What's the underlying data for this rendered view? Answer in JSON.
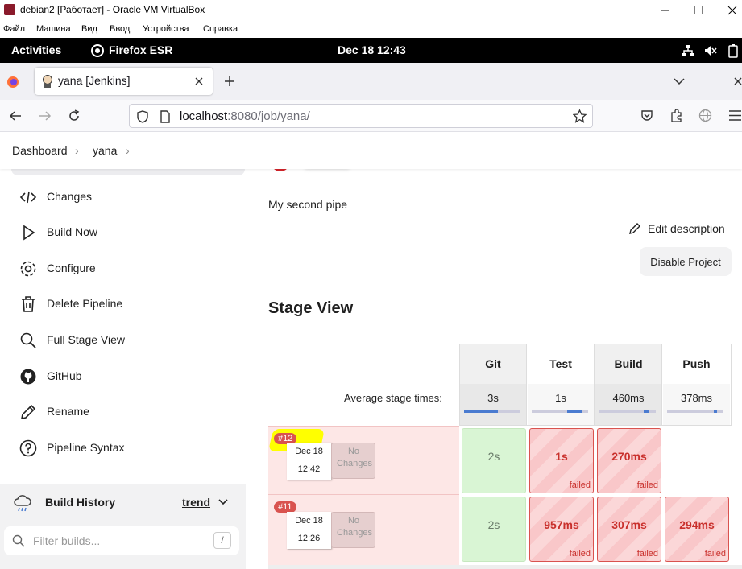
{
  "window": {
    "title": "debian2 [Работает] - Oracle VM VirtualBox",
    "menu": [
      "Файл",
      "Машина",
      "Вид",
      "Ввод",
      "Устройства",
      "Справка"
    ]
  },
  "gnome": {
    "activities": "Activities",
    "app": "Firefox ESR",
    "clock": "Dec 18  12:43"
  },
  "browser": {
    "tab_title": "yana [Jenkins]",
    "url_host": "localhost",
    "url_path": ":8080/job/yana/"
  },
  "breadcrumb": [
    "Dashboard",
    "yana"
  ],
  "sidebar": {
    "items": [
      {
        "label": "Changes",
        "icon": "code-icon"
      },
      {
        "label": "Build Now",
        "icon": "play-icon"
      },
      {
        "label": "Configure",
        "icon": "gear-icon"
      },
      {
        "label": "Delete Pipeline",
        "icon": "trash-icon"
      },
      {
        "label": "Full Stage View",
        "icon": "search-icon"
      },
      {
        "label": "GitHub",
        "icon": "github-icon"
      },
      {
        "label": "Rename",
        "icon": "pencil-icon"
      },
      {
        "label": "Pipeline Syntax",
        "icon": "help-icon"
      }
    ],
    "build_history": "Build History",
    "trend": "trend",
    "filter_placeholder": "Filter builds...",
    "filter_shortcut": "/"
  },
  "main": {
    "description": "My second pipe",
    "edit_description": "Edit description",
    "disable_project": "Disable Project",
    "stage_view_title": "Stage View",
    "avg_label": "Average stage times:",
    "stages": [
      {
        "name": "Git",
        "avg": "3s",
        "avg_fraction": 0.6
      },
      {
        "name": "Test",
        "avg": "1s",
        "avg_fraction": 0.25
      },
      {
        "name": "Build",
        "avg": "460ms",
        "avg_fraction": 0.1
      },
      {
        "name": "Push",
        "avg": "378ms",
        "avg_fraction": 0.05
      }
    ],
    "builds": [
      {
        "number": "#12",
        "date": "Dec 18",
        "time": "12:42",
        "changes": "No Changes",
        "cells": [
          {
            "value": "2s",
            "status": ""
          },
          {
            "value": "1s",
            "status": "failed"
          },
          {
            "value": "270ms",
            "status": "failed"
          },
          {
            "value": "",
            "status": ""
          }
        ]
      },
      {
        "number": "#11",
        "date": "Dec 18",
        "time": "12:26",
        "changes": "No Changes",
        "cells": [
          {
            "value": "2s",
            "status": ""
          },
          {
            "value": "957ms",
            "status": "failed"
          },
          {
            "value": "307ms",
            "status": "failed"
          },
          {
            "value": "294ms",
            "status": "failed"
          }
        ]
      }
    ]
  },
  "colors": {
    "success": "#d9f5d4",
    "failed": "#f9c7c9",
    "failed_text": "#c9302c",
    "build_badge": "#d9534f",
    "highlight": "#ffff00"
  }
}
